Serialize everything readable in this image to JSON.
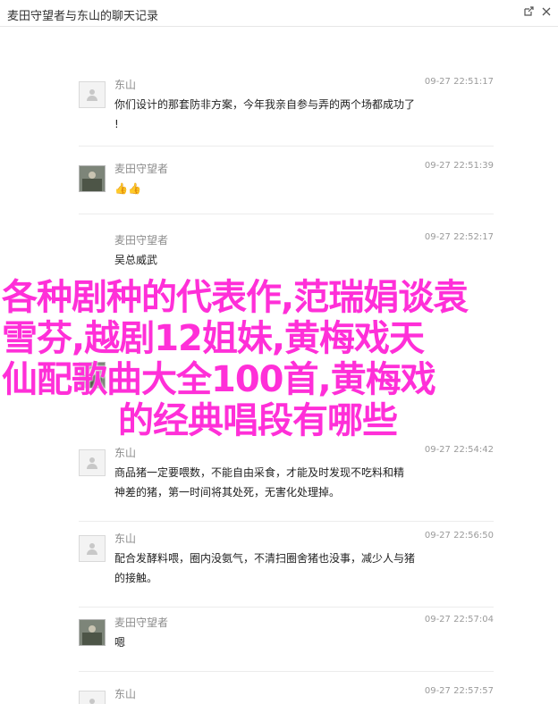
{
  "window": {
    "title": "麦田守望者与东山的聊天记录"
  },
  "overlay": {
    "line1": "各种剧种的代表作,范瑞娟谈袁",
    "line2": "雪芬,越剧12姐妹,黄梅戏天",
    "line3": "仙配歌曲大全100首,黄梅戏",
    "line4": "的经典唱段有哪些",
    "color": "#ff2fd8"
  },
  "messages": [
    {
      "name": "东山",
      "time": "09-27 22:51:17",
      "text": "你们设计的那套防非方案，今年我亲自参与弄的两个场都成功了\n!",
      "avatar": "placeholder"
    },
    {
      "name": "麦田守望者",
      "time": "09-27 22:51:39",
      "text": "👍👍",
      "avatar": "photo"
    },
    {
      "name": "麦田守望者",
      "time": "09-27 22:52:17",
      "text": "吴总威武",
      "avatar": "none"
    },
    {
      "name": "",
      "time": "",
      "text": "",
      "avatar": "none"
    },
    {
      "name": "",
      "time": "",
      "text": "",
      "avatar": "photo"
    },
    {
      "name": "东山",
      "time": "09-27 22:54:42",
      "text": "商品猪一定要喂数，不能自由采食，才能及时发现不吃料和精\n神差的猪，第一时间将其处死，无害化处理掉。",
      "avatar": "placeholder"
    },
    {
      "name": "东山",
      "time": "09-27 22:56:50",
      "text": "配合发酵料喂，圈内没氨气，不清扫圈舍猪也没事，减少人与猪\n的接触。",
      "avatar": "placeholder"
    },
    {
      "name": "麦田守望者",
      "time": "09-27 22:57:04",
      "text": "嗯",
      "avatar": "photo"
    },
    {
      "name": "东山",
      "time": "09-27 22:57:57",
      "text": "",
      "avatar": "placeholder"
    }
  ]
}
